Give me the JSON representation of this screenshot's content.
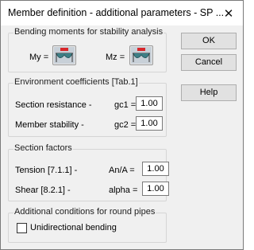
{
  "window": {
    "title": "Member definition - additional parameters - SP ...",
    "close_glyph": "✕"
  },
  "bending": {
    "group_title": "Bending moments for stability analysis",
    "my_label": "My =",
    "mz_label": "Mz =",
    "my_icon": "moment-diagram-icon",
    "mz_icon": "moment-diagram-icon"
  },
  "environment": {
    "group_title": "Environment coefficients [Tab.1]",
    "section_resistance_label": "Section resistance -",
    "gc1_label": "gc1 =",
    "gc1_value": "1.00",
    "member_stability_label": "Member stability -",
    "gc2_label": "gc2 =",
    "gc2_value": "1.00"
  },
  "section_factors": {
    "group_title": "Section factors",
    "tension_label": "Tension [7.1.1] -",
    "ana_label": "An/A =",
    "ana_value": "1.00",
    "shear_label": "Shear [8.2.1] -",
    "alpha_label": "alpha =",
    "alpha_value": "1.00"
  },
  "round_pipes": {
    "group_title": "Additional conditions for round pipes",
    "unidirectional_label": "Unidirectional bending",
    "unidirectional_checked": false
  },
  "buttons": {
    "ok": "OK",
    "cancel": "Cancel",
    "help": "Help"
  },
  "colors": {
    "icon_red": "#d8262a",
    "icon_teal": "#3e7f86",
    "icon_bg": "#c8d0d8"
  }
}
